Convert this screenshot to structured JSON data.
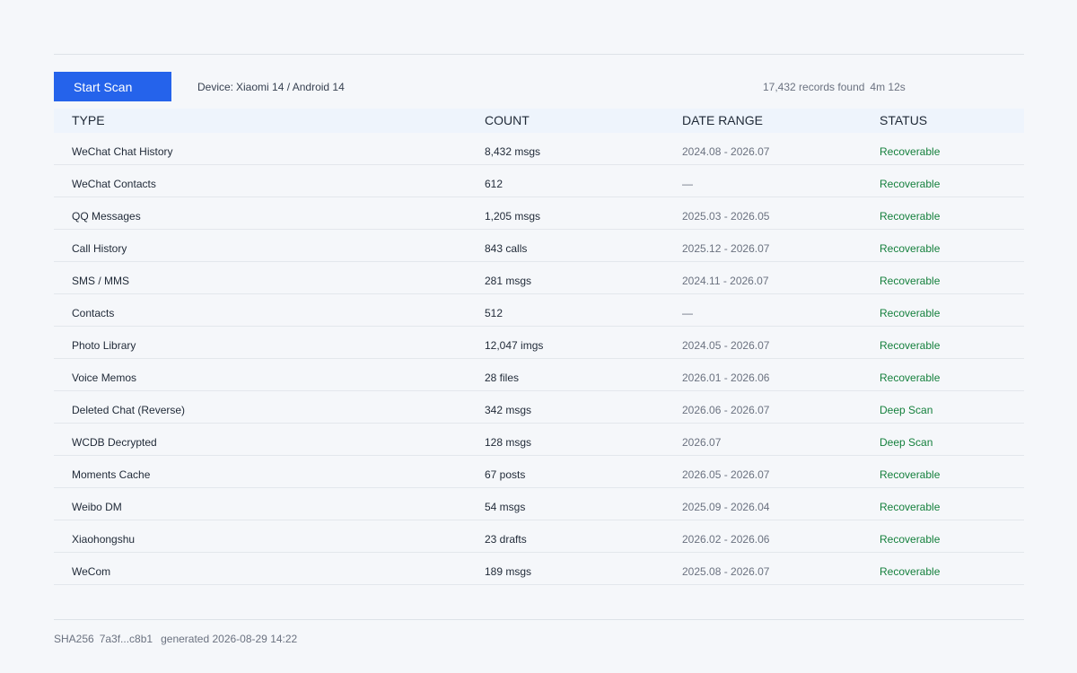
{
  "toolbar": {
    "scan_button_label": "Start Scan",
    "device_label": "Device:",
    "device_value": "Xiaomi 14 / Android 14",
    "records_found": "17,432 records found",
    "duration": "4m 12s"
  },
  "table": {
    "headers": {
      "type": "TYPE",
      "count": "COUNT",
      "date_range": "DATE RANGE",
      "status": "STATUS"
    },
    "rows": [
      {
        "type": "WeChat Chat History",
        "count": "8,432 msgs",
        "date_range": "2024.08 - 2026.07",
        "status": "Recoverable"
      },
      {
        "type": "WeChat Contacts",
        "count": "612",
        "date_range": "—",
        "status": "Recoverable"
      },
      {
        "type": "QQ Messages",
        "count": "1,205 msgs",
        "date_range": "2025.03 - 2026.05",
        "status": "Recoverable"
      },
      {
        "type": "Call History",
        "count": "843 calls",
        "date_range": "2025.12 - 2026.07",
        "status": "Recoverable"
      },
      {
        "type": "SMS / MMS",
        "count": "281 msgs",
        "date_range": "2024.11 - 2026.07",
        "status": "Recoverable"
      },
      {
        "type": "Contacts",
        "count": "512",
        "date_range": "—",
        "status": "Recoverable"
      },
      {
        "type": "Photo Library",
        "count": "12,047 imgs",
        "date_range": "2024.05 - 2026.07",
        "status": "Recoverable"
      },
      {
        "type": "Voice Memos",
        "count": "28 files",
        "date_range": "2026.01 - 2026.06",
        "status": "Recoverable"
      },
      {
        "type": "Deleted Chat (Reverse)",
        "count": "342 msgs",
        "date_range": "2026.06 - 2026.07",
        "status": "Deep Scan"
      },
      {
        "type": "WCDB Decrypted",
        "count": "128 msgs",
        "date_range": "2026.07",
        "status": "Deep Scan"
      },
      {
        "type": "Moments Cache",
        "count": "67 posts",
        "date_range": "2026.05 - 2026.07",
        "status": "Recoverable"
      },
      {
        "type": "Weibo DM",
        "count": "54 msgs",
        "date_range": "2025.09 - 2026.04",
        "status": "Recoverable"
      },
      {
        "type": "Xiaohongshu",
        "count": "23 drafts",
        "date_range": "2026.02 - 2026.06",
        "status": "Recoverable"
      },
      {
        "type": "WeCom",
        "count": "189 msgs",
        "date_range": "2025.08 - 2026.07",
        "status": "Recoverable"
      }
    ]
  },
  "footer": {
    "hash_label": "SHA256",
    "hash_value": "7a3f...c8b1",
    "generated": "generated 2026-08-29 14:22"
  },
  "colors": {
    "accent": "#2563eb",
    "status_green": "#15803d",
    "header_bg": "#eef4fc",
    "page_bg": "#f5f7fa"
  }
}
